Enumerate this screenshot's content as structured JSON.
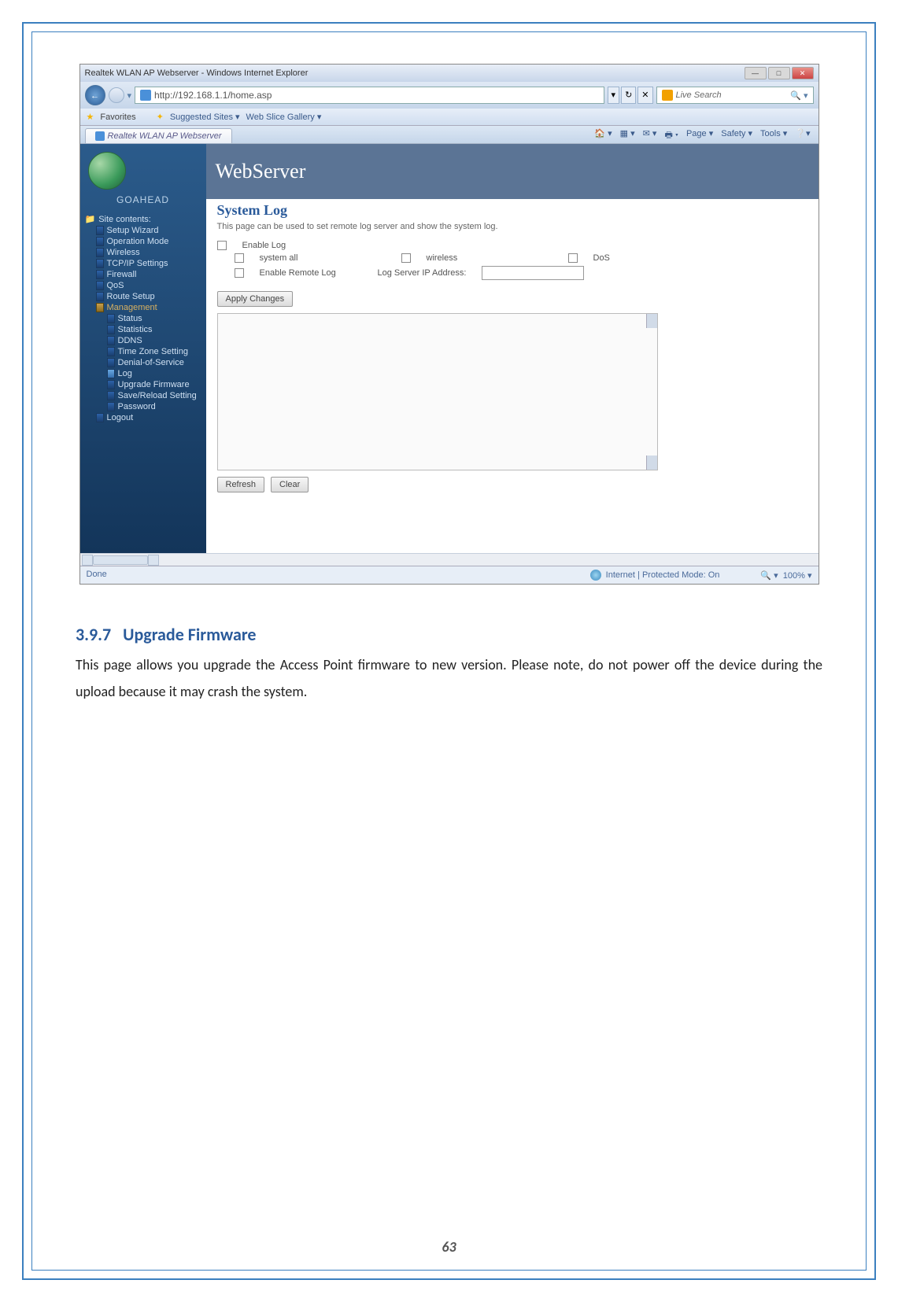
{
  "browser": {
    "window_title": "Realtek WLAN AP Webserver - Windows Internet Explorer",
    "url": "http://192.168.1.1/home.asp",
    "search_placeholder": "Live Search",
    "fav_label": "Favorites",
    "suggested_sites": "Suggested Sites",
    "web_slice": "Web Slice Gallery",
    "tab_title": "Realtek WLAN AP Webserver",
    "cmdbar": {
      "page": "Page",
      "safety": "Safety",
      "tools": "Tools"
    },
    "sidebar": {
      "brand": "GoAhead",
      "root": "Site contents:",
      "items": [
        "Setup Wizard",
        "Operation Mode",
        "Wireless",
        "TCP/IP Settings",
        "Firewall",
        "QoS",
        "Route Setup"
      ],
      "management": "Management",
      "mgmt_items": [
        "Status",
        "Statistics",
        "DDNS",
        "Time Zone Setting",
        "Denial-of-Service",
        "Log",
        "Upgrade Firmware",
        "Save/Reload Setting",
        "Password"
      ],
      "logout": "Logout"
    },
    "content": {
      "banner": "WebServer",
      "title": "System Log",
      "desc": "This page can be used to set remote log server and show the system log.",
      "enable_log": "Enable Log",
      "system_all": "system all",
      "wireless": "wireless",
      "dos": "DoS",
      "enable_remote": "Enable Remote Log",
      "log_server": "Log Server IP Address:",
      "apply": "Apply Changes",
      "refresh": "Refresh",
      "clear": "Clear"
    },
    "status": {
      "done": "Done",
      "zone": "Internet | Protected Mode: On",
      "zoom": "100%"
    }
  },
  "doc": {
    "heading_num": "3.9.7",
    "heading_text": "Upgrade Firmware",
    "paragraph": "This page allows you upgrade the Access Point firmware to new version. Please note, do not power off the device during the upload because it may crash the system.",
    "page_number": "63"
  }
}
